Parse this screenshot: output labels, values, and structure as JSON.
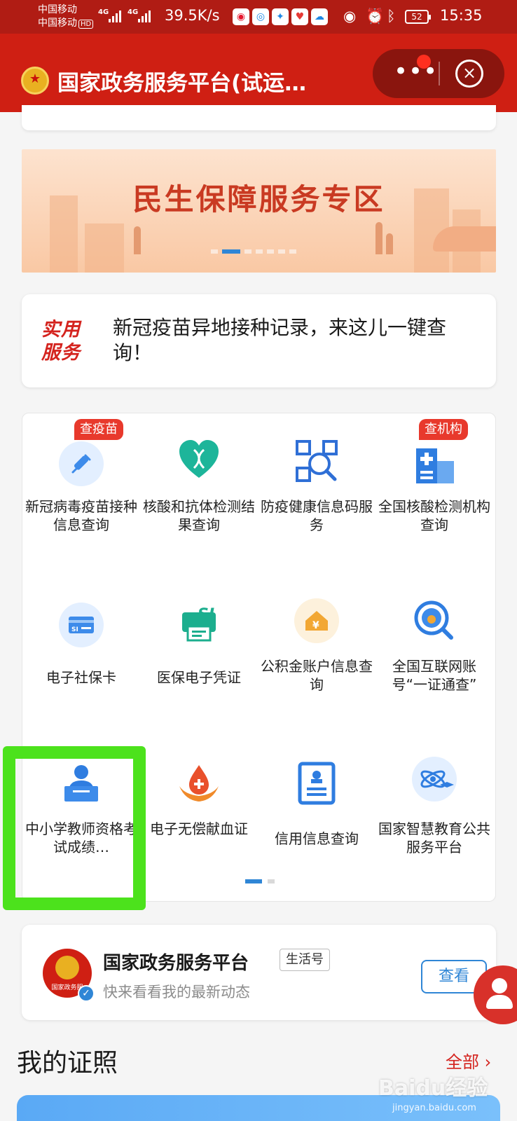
{
  "status_bar": {
    "carrier_1": "中国移动",
    "carrier_2": "中国移动",
    "hd_label": "HD",
    "signal_1": "4G",
    "signal_2": "4G",
    "net_speed": "39.5K/s",
    "battery": "52",
    "time": "15:35"
  },
  "title_bar": {
    "title": "国家政务服务平台(试运…"
  },
  "banner": {
    "title": "民生保障服务专区"
  },
  "notice": {
    "tag": "实用服务",
    "text": "新冠疫苗异地接种记录，来这儿一键查询！"
  },
  "services": [
    {
      "label": "新冠病毒疫苗接种信息查询",
      "badge": "查疫苗",
      "icon": "syringe-icon"
    },
    {
      "label": "核酸和抗体检测结果查询",
      "badge": "",
      "icon": "dna-heart-icon"
    },
    {
      "label": "防疫健康信息码服务",
      "badge": "",
      "icon": "qr-scan-icon"
    },
    {
      "label": "全国核酸检测机构查询",
      "badge": "查机构",
      "icon": "hospital-icon"
    },
    {
      "label": "电子社保卡",
      "badge": "",
      "icon": "social-security-card-icon"
    },
    {
      "label": "医保电子凭证",
      "badge": "",
      "icon": "medical-insurance-icon"
    },
    {
      "label": "公积金账户信息查询",
      "badge": "",
      "icon": "housing-fund-icon"
    },
    {
      "label": "全国互联网账号“一证通查”",
      "badge": "",
      "icon": "account-search-icon"
    },
    {
      "label": "中小学教师资格考试成绩…",
      "badge": "",
      "icon": "teacher-icon"
    },
    {
      "label": "电子无偿献血证",
      "badge": "",
      "icon": "blood-donation-icon"
    },
    {
      "label": "信用信息查询",
      "badge": "",
      "icon": "credit-document-icon"
    },
    {
      "label": "国家智慧教育公共服务平台",
      "badge": "",
      "icon": "smart-education-icon"
    }
  ],
  "life_account": {
    "name": "国家政务服务平台",
    "tag": "生活号",
    "subtitle": "快来看看我的最新动态",
    "avatar_text": "国家政务服",
    "view_button": "查看"
  },
  "licenses": {
    "title": "我的证照",
    "all_link": "全部 ›"
  },
  "watermark": {
    "text": "Baidu经验",
    "sub": "jingyan.baidu.com"
  },
  "colors": {
    "header_red": "#cf1f13",
    "accent_blue": "#2f86d6",
    "badge_red": "#e8392c",
    "highlight_green": "#4ce21c"
  }
}
